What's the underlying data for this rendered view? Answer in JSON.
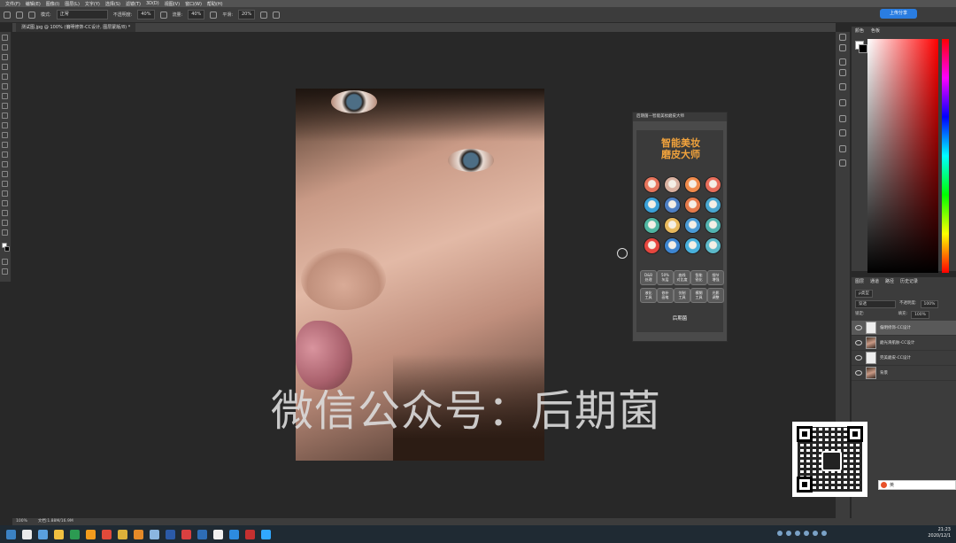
{
  "menubar": {
    "items": [
      "文件(F)",
      "编辑(E)",
      "图像(I)",
      "图层(L)",
      "文字(Y)",
      "选择(S)",
      "滤镜(T)",
      "3D(D)",
      "视图(V)",
      "窗口(W)",
      "帮助(H)"
    ]
  },
  "options": {
    "mode_label": "模式:",
    "mode_value": "正常",
    "opacity_label": "不透明度:",
    "opacity_value": "40%",
    "flow_label": "流量:",
    "flow_value": "40%",
    "smooth_label": "平滑:",
    "smooth_value": "20%"
  },
  "document": {
    "tab_title": "测试图.jpg @ 100% (偏明修饰-CC设计, 图层蒙版/8) *"
  },
  "watermark": "微信公众号：后期菌",
  "plugin": {
    "title": "后期菌—智能美妆磨皮大师",
    "logo_line1": "智能美妆",
    "logo_line2": "磨皮大师",
    "icon_colors": [
      "#e6735a",
      "#d9b1a0",
      "#f08a4b",
      "#e86d5a",
      "#3aa0d8",
      "#4d7fc4",
      "#e67a4a",
      "#48a6cf",
      "#4fb5a1",
      "#e8b85c",
      "#4a9bd6",
      "#52b3b0",
      "#e5463e",
      "#3d86d2",
      "#48b0dc",
      "#5cb9c9"
    ],
    "row1_buttons": [
      "D&B\n处理",
      "50%\n灰层",
      "曲线\n对比度",
      "智能\n锐化",
      "细节\n增强"
    ],
    "row2_buttons": [
      "液化\n工具",
      "修补\n画笔",
      "仿制\n工具",
      "模糊\n工具",
      "光影\n调整"
    ],
    "footer": "后期菌"
  },
  "color_panel": {
    "tabs": [
      "颜色",
      "色板"
    ]
  },
  "layers_panel": {
    "tabs": [
      "图层",
      "通道",
      "路径",
      "历史记录"
    ],
    "kind_label": "ρ类型",
    "blend_mode": "穿透",
    "opacity_label": "不透明度:",
    "opacity_value": "100%",
    "lock_label": "锁定:",
    "fill_label": "填充:",
    "fill_value": "100%",
    "layers": [
      {
        "name": "偏明修饰-CC设计",
        "selected": true
      },
      {
        "name": "磨光滑肌肤-CC设计",
        "selected": false
      },
      {
        "name": "完美磨皮-CC设计",
        "selected": false
      },
      {
        "name": "背景",
        "selected": false
      }
    ]
  },
  "statusbar": {
    "zoom": "100%",
    "doc": "文档:1.88M/16.9M"
  },
  "ime": {
    "label": "英"
  },
  "cloud_button": "上传分享",
  "taskbar": {
    "time": "21:23",
    "date": "2020/12/1",
    "icon_colors": [
      "#3b82c4",
      "#eaeaea",
      "#5aa0de",
      "#f0c040",
      "#2c9b52",
      "#f29b1d",
      "#e04a3a",
      "#dcb13a",
      "#e58a28",
      "#8bb6e0",
      "#2b5aa8",
      "#d94040",
      "#2e6db5",
      "#f0f0f0",
      "#2d8be0",
      "#c53030",
      "#31a8ff"
    ]
  }
}
